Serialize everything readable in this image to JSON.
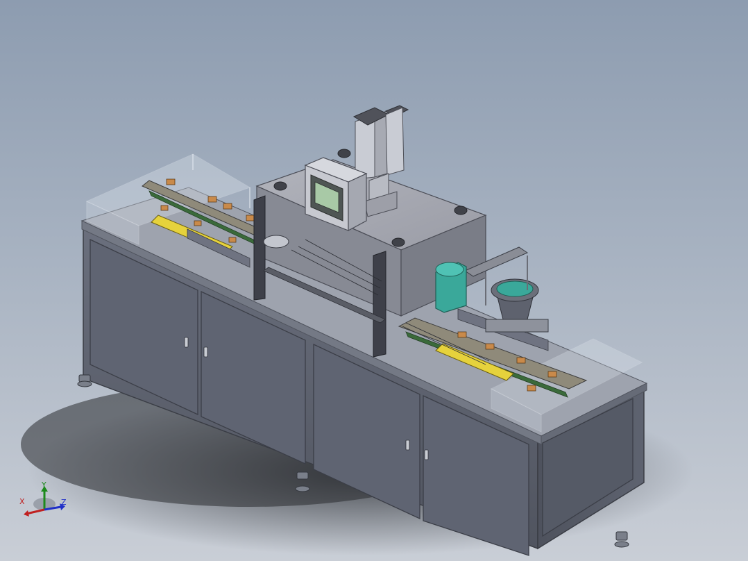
{
  "viewport": {
    "background_top": "#8d9cb0",
    "background_bottom": "#c9ced6"
  },
  "model": {
    "cabinet_color": "#5c6170",
    "frame_color": "#7f8595",
    "cover_color": "#dfe6ee",
    "yellow_part": "#e6d23c",
    "teal_part": "#3aa89a",
    "copper_part": "#c98a4a"
  },
  "triad": {
    "x_label": "X",
    "y_label": "Y",
    "z_label": "Z",
    "x_color": "#c02020",
    "y_color": "#1c8a1c",
    "z_color": "#2030c8"
  }
}
